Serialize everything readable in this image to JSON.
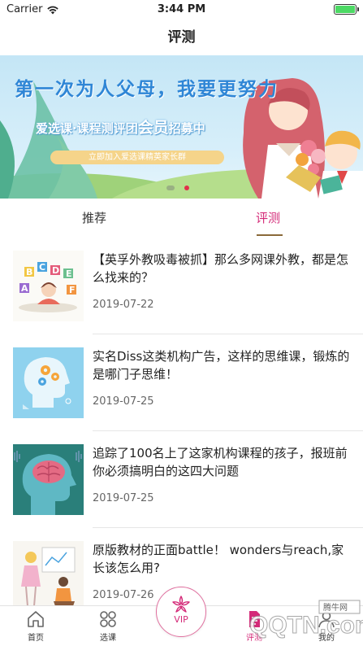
{
  "status_bar": {
    "carrier": "Carrier",
    "time": "3:44 PM",
    "icons": [
      "wifi-icon",
      "battery-icon"
    ]
  },
  "nav": {
    "title": "评测"
  },
  "banner": {
    "headline": "第一次为人父母，我要更努力",
    "subtitle_prefix": "爱选课·课程测评团",
    "subtitle_emphasis": "会员",
    "subtitle_suffix": "招募中",
    "pill_text": "立即加入爱选课精英家长群",
    "carousel_dots": 2,
    "active_dot": 1
  },
  "tabs": {
    "items": [
      {
        "label": "推荐",
        "active": false
      },
      {
        "label": "评测",
        "active": true
      }
    ],
    "active_color": "#d42a78"
  },
  "articles": [
    {
      "title": "【英孚外教吸毒被抓】那么多网课外教，都是怎么找来的？",
      "date": "2019-07-22",
      "thumb": "abc-letters-illustration"
    },
    {
      "title": "实名Diss这类机构广告，这样的思维课，锻炼的是哪门子思维！",
      "date": "2019-07-25",
      "thumb": "head-gears-illustration"
    },
    {
      "title": "追踪了100名上了这家机构课程的孩子，报班前你必须搞明白的这四大问题",
      "date": "2019-07-25",
      "thumb": "brain-head-illustration"
    },
    {
      "title": "原版教材的正面battle！ wonders与reach,家长该怎么用?",
      "date": "2019-07-26",
      "thumb": "teacher-student-illustration"
    }
  ],
  "tabbar": {
    "items": [
      {
        "label": "首页",
        "icon": "home-icon"
      },
      {
        "label": "选课",
        "icon": "grid-icon"
      },
      {
        "label": "VIP",
        "icon": "vip-flower-icon"
      },
      {
        "label": "评测",
        "icon": "document-icon"
      },
      {
        "label": "我的",
        "icon": "user-icon"
      }
    ]
  },
  "watermark": {
    "text": "QQTN.com",
    "badge": "腾牛网"
  },
  "colors": {
    "accent": "#d42a78",
    "banner_text": "#2f86d6"
  }
}
